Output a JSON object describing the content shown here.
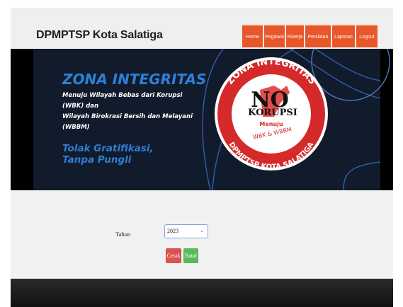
{
  "header": {
    "brand": "DPMPTSP Kota Salatiga",
    "nav": [
      "Home",
      "Pegawai",
      "Kinerja",
      "Penilaian",
      "Laporan",
      "Logout"
    ]
  },
  "banner": {
    "title": "ZONA INTEGRITAS",
    "subtitle_lines": [
      "Menuju Wilayah Bebas dari Korupsi",
      "(WBK) dan",
      "Wilayah Birokrasi Bersih dan Melayani",
      "(WBBM)"
    ],
    "slogan_lines": [
      "Tolak Gratifikasi,",
      "Tanpa Pungli"
    ],
    "emblem": {
      "ring_top": "ZONA INTEGRITAS",
      "no": "NO",
      "korupsi": "KORUPSI",
      "menuju": "Menuju",
      "wbk": "WBK & WBBM",
      "ring_bottom": "DPMPTSP KOTA SALATIGA"
    }
  },
  "form": {
    "tahun_label": "Tahun",
    "tahun_value": "2023",
    "cetak_label": "Cetak",
    "batal_label": "Batal"
  },
  "colors": {
    "nav_bg": "#e8562a",
    "banner_bg": "#121b2c",
    "accent_blue": "#2e7fd6",
    "emblem_red": "#d42a2a",
    "cetak": "#d9534f",
    "batal": "#5cb85c"
  }
}
